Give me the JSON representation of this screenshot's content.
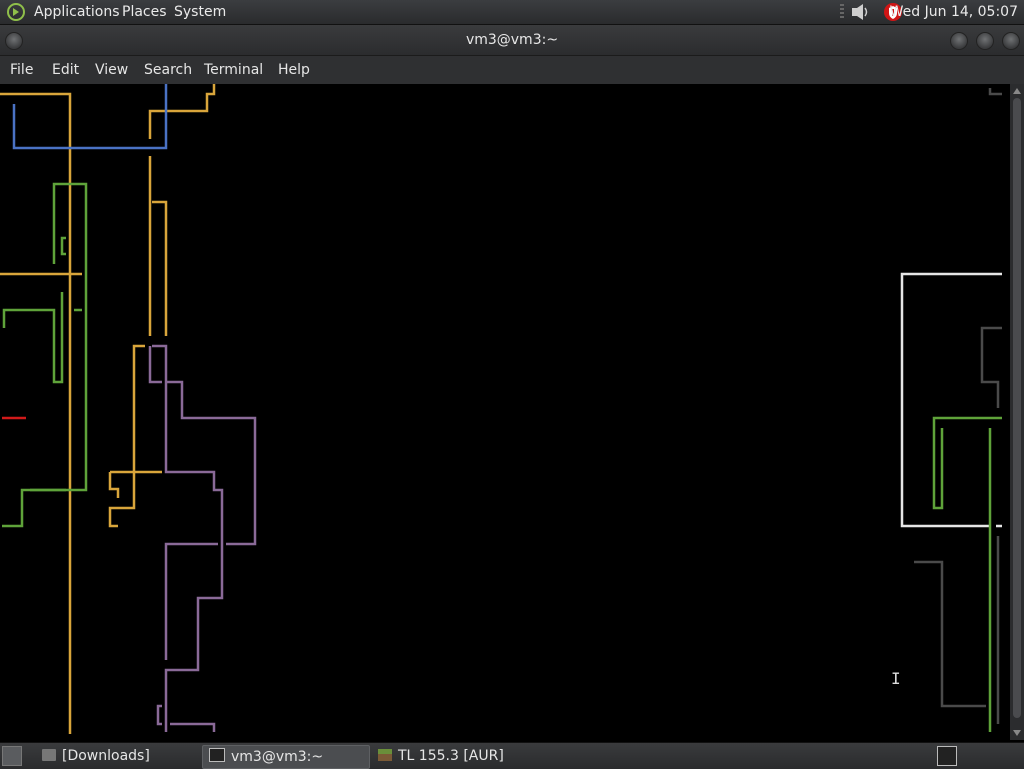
{
  "top_panel": {
    "menus": [
      "Applications",
      "Places",
      "System"
    ],
    "clock": "Wed Jun 14, 05:07",
    "icons": [
      "app-menu-logo-icon",
      "volume-icon",
      "shield-icon"
    ]
  },
  "window": {
    "title": "vm3@vm3:~",
    "menu": [
      "File",
      "Edit",
      "View",
      "Search",
      "Terminal",
      "Help"
    ]
  },
  "terminal": {
    "background": "#000000",
    "pipe_colors": {
      "yellow": "#d9a53b",
      "blue": "#4a72c4",
      "green": "#5fa33a",
      "purple": "#8a6a98",
      "red": "#d11a1a",
      "white": "#e6e6e6",
      "gray": "#4a4a4a"
    }
  },
  "taskbar": {
    "items": [
      {
        "label": "[Downloads]",
        "icon": "folder-icon",
        "active": false
      },
      {
        "label": "vm3@vm3:~",
        "icon": "terminal-icon",
        "active": true
      },
      {
        "label": "TL 155.3 [AUR]",
        "icon": "game-cube-icon",
        "active": false
      }
    ]
  }
}
